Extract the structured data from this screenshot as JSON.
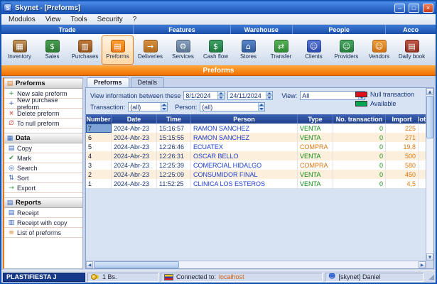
{
  "window": {
    "title": "Skynet - [Preforms]",
    "controls": {
      "minimize": "–",
      "maximize": "□",
      "close": "×"
    }
  },
  "menubar": {
    "items": [
      "Modulos",
      "View",
      "Tools",
      "Security",
      "?"
    ]
  },
  "ribbon": {
    "categories": [
      {
        "label": "Trade"
      },
      {
        "label": "Features"
      },
      {
        "label": "Warehouse"
      },
      {
        "label": "People"
      },
      {
        "label": "Acco"
      }
    ],
    "tools": [
      {
        "label": "Inventory",
        "glyph": "▦"
      },
      {
        "label": "Sales",
        "glyph": "$"
      },
      {
        "label": "Purchases",
        "glyph": "▥"
      },
      {
        "label": "Preforms",
        "glyph": "▤",
        "active": true
      },
      {
        "label": "Deliveries",
        "glyph": "→"
      },
      {
        "label": "Services",
        "glyph": "⚙"
      },
      {
        "label": "Cash flow",
        "glyph": "$"
      },
      {
        "label": "Stores",
        "glyph": "⌂"
      },
      {
        "label": "Transfer",
        "glyph": "⇄"
      },
      {
        "label": "Clients",
        "glyph": "☺"
      },
      {
        "label": "Providers",
        "glyph": "☺"
      },
      {
        "label": "Vendors",
        "glyph": "☺"
      },
      {
        "label": "Daily book",
        "glyph": "▤"
      }
    ]
  },
  "banner": {
    "title": "Preforms"
  },
  "sidebar": {
    "sections": [
      {
        "title": "Preforms",
        "glyph": "▤",
        "items": [
          {
            "label": "New sale preform",
            "glyph": "+"
          },
          {
            "label": "New purchase preform",
            "glyph": "+"
          },
          {
            "label": "Delete preform",
            "glyph": "×"
          },
          {
            "label": "To null preform",
            "glyph": "∅"
          }
        ]
      },
      {
        "title": "Data",
        "glyph": "▦",
        "items": [
          {
            "label": "Copy",
            "glyph": "▤"
          },
          {
            "label": "Mark",
            "glyph": "✔"
          },
          {
            "label": "Search",
            "glyph": "◎"
          },
          {
            "label": "Sort",
            "glyph": "⇅"
          },
          {
            "label": "Export",
            "glyph": "→"
          }
        ]
      },
      {
        "title": "Reports",
        "glyph": "▤",
        "items": [
          {
            "label": "Receipt",
            "glyph": "▤"
          },
          {
            "label": "Receipt with copy",
            "glyph": "▥"
          },
          {
            "label": "List of preforms",
            "glyph": "≡"
          }
        ]
      }
    ]
  },
  "main": {
    "tabs": [
      {
        "label": "Preforms",
        "active": true
      },
      {
        "label": "Details"
      }
    ],
    "filters": {
      "range_label": "View information between these",
      "date_from": "8/1/2024",
      "date_to": "24/11/2024",
      "view_label": "View:",
      "view_value": "All",
      "transaction_label": "Transaction:",
      "transaction_value": "(all)",
      "person_label": "Person:",
      "person_value": "(all)",
      "legend": [
        {
          "label": "Null transaction",
          "color": "#e0101c"
        },
        {
          "label": "Available",
          "color": "#00a651"
        }
      ]
    },
    "table": {
      "headers": [
        "Number",
        "Date",
        "Time",
        "Person",
        "Type",
        "No. transaction",
        "Import",
        "Note"
      ],
      "type_colors": {
        "VENTA": "#0e8a12",
        "COMPRA": "#e0760e"
      },
      "rows": [
        {
          "number": "7",
          "date": "2024-Abr-23",
          "time": "15:16:57",
          "person": "RAMON SANCHEZ",
          "type": "VENTA",
          "no_transaction": "0",
          "import": "225",
          "note": ""
        },
        {
          "number": "6",
          "date": "2024-Abr-23",
          "time": "15:15:55",
          "person": "RAMON SANCHEZ",
          "type": "VENTA",
          "no_transaction": "0",
          "import": "271",
          "note": ""
        },
        {
          "number": "5",
          "date": "2024-Abr-23",
          "time": "12:26:46",
          "person": "ECUATEX",
          "type": "COMPRA",
          "no_transaction": "0",
          "import": "19,8",
          "note": ""
        },
        {
          "number": "4",
          "date": "2024-Abr-23",
          "time": "12:26:31",
          "person": "OSCAR BELLO",
          "type": "VENTA",
          "no_transaction": "0",
          "import": "500",
          "note": ""
        },
        {
          "number": "3",
          "date": "2024-Abr-23",
          "time": "12:25:39",
          "person": "COMERCIAL HIDALGO",
          "type": "COMPRA",
          "no_transaction": "0",
          "import": "580",
          "note": ""
        },
        {
          "number": "2",
          "date": "2024-Abr-23",
          "time": "12:25:09",
          "person": "CONSUMIDOR FINAL",
          "type": "VENTA",
          "no_transaction": "0",
          "import": "450",
          "note": ""
        },
        {
          "number": "1",
          "date": "2024-Abr-23",
          "time": "11:52:25",
          "person": "CLINICA LOS ESTEROS",
          "type": "VENTA",
          "no_transaction": "0",
          "import": "4,5",
          "note": ""
        }
      ]
    }
  },
  "statusbar": {
    "company": "PLASTIFIESTA J",
    "currency": "1 Bs.",
    "connected_label": "Connected to:",
    "connected_value": "localhost",
    "user": "[skynet] Daniel"
  }
}
